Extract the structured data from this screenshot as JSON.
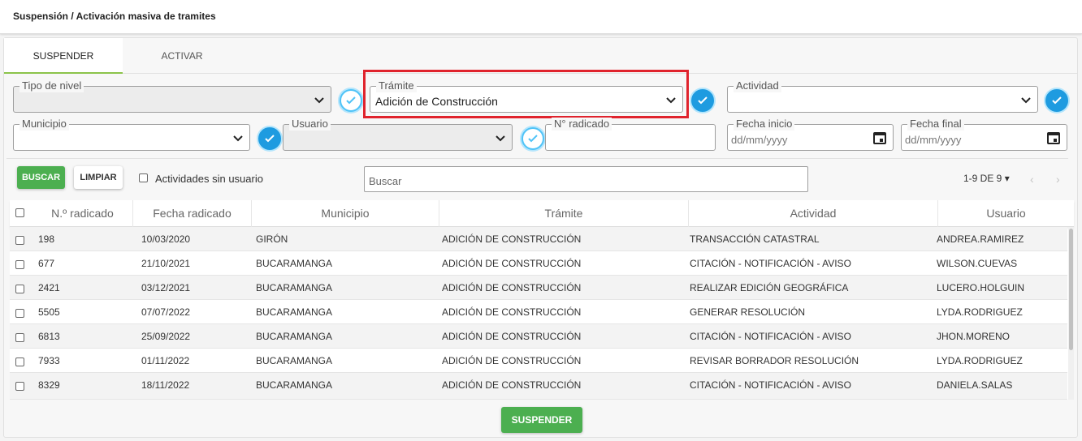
{
  "page": {
    "title": "Suspensión / Activación masiva de tramites"
  },
  "tabs": [
    {
      "label": "SUSPENDER",
      "active": true
    },
    {
      "label": "ACTIVAR",
      "active": false
    }
  ],
  "filters": {
    "tipo_nivel": {
      "label": "Tipo de nivel",
      "value": ""
    },
    "tramite": {
      "label": "Trámite",
      "value": "Adición de Construcción"
    },
    "actividad": {
      "label": "Actividad",
      "value": ""
    },
    "municipio": {
      "label": "Municipio",
      "value": ""
    },
    "usuario": {
      "label": "Usuario",
      "value": ""
    },
    "n_radicado": {
      "label": "N° radicado",
      "value": ""
    },
    "fecha_inicio": {
      "label": "Fecha inicio",
      "placeholder": "dd/mm/yyyy"
    },
    "fecha_final": {
      "label": "Fecha final",
      "placeholder": "dd/mm/yyyy"
    }
  },
  "toolbar": {
    "buscar_label": "BUSCAR",
    "limpiar_label": "LIMPIAR",
    "sin_usuario_label": "Actividades sin usuario",
    "search_placeholder": "Buscar",
    "pagination": "1-9 DE 9 ▾"
  },
  "table": {
    "headers": [
      "N.º radicado",
      "Fecha radicado",
      "Municipio",
      "Trámite",
      "Actividad",
      "Usuario"
    ],
    "rows": [
      {
        "radicado": "198",
        "fecha": "10/03/2020",
        "municipio": "GIRÓN",
        "tramite": "ADICIÓN DE CONSTRUCCIÓN",
        "actividad": "TRANSACCIÓN CATASTRAL",
        "usuario": "ANDREA.RAMIREZ"
      },
      {
        "radicado": "677",
        "fecha": "21/10/2021",
        "municipio": "BUCARAMANGA",
        "tramite": "ADICIÓN DE CONSTRUCCIÓN",
        "actividad": "CITACIÓN - NOTIFICACIÓN - AVISO",
        "usuario": "WILSON.CUEVAS"
      },
      {
        "radicado": "2421",
        "fecha": "03/12/2021",
        "municipio": "BUCARAMANGA",
        "tramite": "ADICIÓN DE CONSTRUCCIÓN",
        "actividad": "REALIZAR EDICIÓN GEOGRÁFICA",
        "usuario": "LUCERO.HOLGUIN"
      },
      {
        "radicado": "5505",
        "fecha": "07/07/2022",
        "municipio": "BUCARAMANGA",
        "tramite": "ADICIÓN DE CONSTRUCCIÓN",
        "actividad": "GENERAR RESOLUCIÓN",
        "usuario": "LYDA.RODRIGUEZ"
      },
      {
        "radicado": "6813",
        "fecha": "25/09/2022",
        "municipio": "BUCARAMANGA",
        "tramite": "ADICIÓN DE CONSTRUCCIÓN",
        "actividad": "CITACIÓN - NOTIFICACIÓN - AVISO",
        "usuario": "JHON.MORENO"
      },
      {
        "radicado": "7933",
        "fecha": "01/11/2022",
        "municipio": "BUCARAMANGA",
        "tramite": "ADICIÓN DE CONSTRUCCIÓN",
        "actividad": "REVISAR BORRADOR RESOLUCIÓN",
        "usuario": "LYDA.RODRIGUEZ"
      },
      {
        "radicado": "8329",
        "fecha": "18/11/2022",
        "municipio": "BUCARAMANGA",
        "tramite": "ADICIÓN DE CONSTRUCCIÓN",
        "actividad": "CITACIÓN - NOTIFICACIÓN - AVISO",
        "usuario": "DANIELA.SALAS"
      }
    ]
  },
  "footer": {
    "suspender_label": "SUSPENDER"
  },
  "colors": {
    "accent_green": "#4caf50",
    "check_blue": "#1e9be0",
    "highlight_red": "#e0232d"
  }
}
